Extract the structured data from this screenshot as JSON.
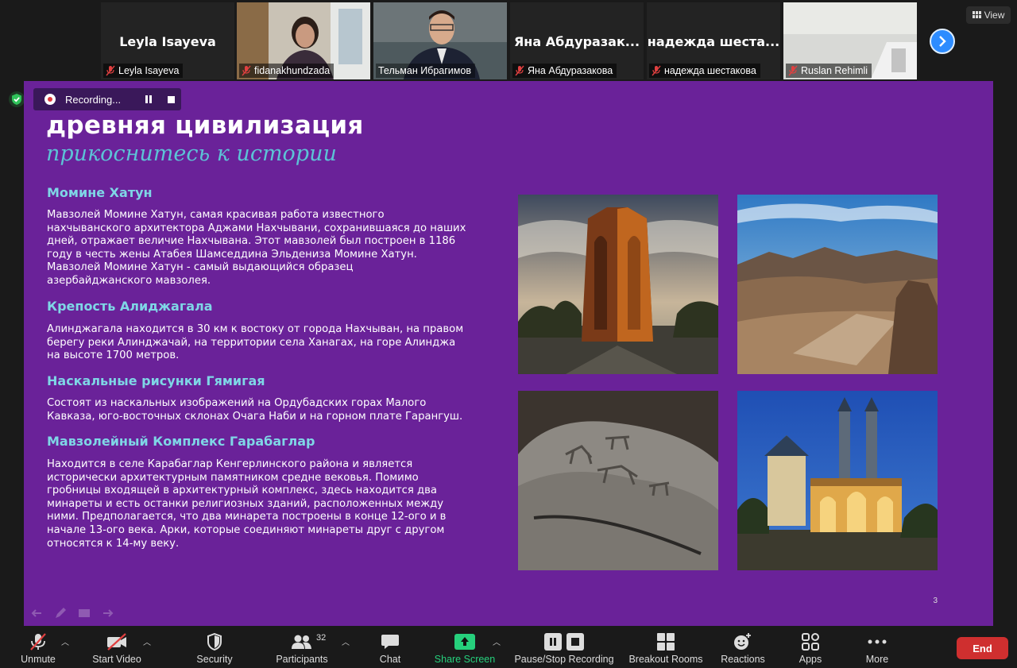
{
  "participants": {
    "tiles": [
      {
        "big_name": "Leyla Isayeva",
        "label": "Leyla Isayeva"
      },
      {
        "label": "fidanakhundzada"
      },
      {
        "label": "Тельман Ибрагимов"
      },
      {
        "big_name": "Яна  Абдуразак...",
        "label": "Яна Абдуразакова"
      },
      {
        "big_name": "надежда  шеста...",
        "label": "надежда шестакова"
      },
      {
        "label": "Ruslan Rehimli"
      }
    ],
    "view_label": "View"
  },
  "recording": {
    "label": "Recording..."
  },
  "slide": {
    "title": "древняя цивилизация",
    "subtitle": "прикоснитесь к истории",
    "sections": [
      {
        "heading": "Момине Хатун",
        "text": "Мавзолей Момине Хатун, самая красивая работа известного\nнахчыванского архитектора Аджами Нахчывани, сохранившаяся до наших\nдней, отражает величие Нахчывана. Этот мавзолей был построен в 1186\nгоду в честь жены Атабея Шамседдина Эльдениза Момине Хатун.\nМавзолей Момине Хатун - самый выдающийся образец\nазербайджанского  мавзолея."
      },
      {
        "heading": "Крепость Алиджагала",
        "text": "Алинджагала находится в 30 км к востоку от города Нахчыван, на правом\nберегу реки Алинджачай, на территории села Ханагах, на горе Алинджа\nна высоте  1700 метров."
      },
      {
        "heading": "Наскальные рисунки Гямигая",
        "text": "Состоят из наскальных изображений  на Ордубадских горах Малого\nКавказа,  юго-восточных склонах Очага Наби и на горном плате Гарангуш."
      },
      {
        "heading": "Мавзолейный Комплекс Гарабаглар",
        "text": "Находится в селе Карабаглар Кенгерлинского района и является\nисторически архитектурным памятником средне вековья. Помимо\nгробницы входящей в архитектурный комплекс, здесь находится два\nминареты и есть останки религиозных зданий, расположенных между\nними. Предполагается, что два минарета построены в конце 12-ого и в\nначале 13-ого века. Арки, которые соединяют минареты друг с другом\nотносятся к 14-му веку."
      }
    ],
    "page_number": "3"
  },
  "toolbar": {
    "unmute": "Unmute",
    "start_video": "Start Video",
    "security": "Security",
    "participants": "Participants",
    "participants_count": "32",
    "chat": "Chat",
    "share_screen": "Share Screen",
    "pause_stop_recording": "Pause/Stop Recording",
    "breakout_rooms": "Breakout Rooms",
    "reactions": "Reactions",
    "apps": "Apps",
    "more": "More",
    "end": "End"
  },
  "colors": {
    "slide_bg": "#6a2299",
    "accent_teal": "#7fd6e6",
    "share_green": "#26d07c",
    "end_red": "#cf2f2f"
  }
}
